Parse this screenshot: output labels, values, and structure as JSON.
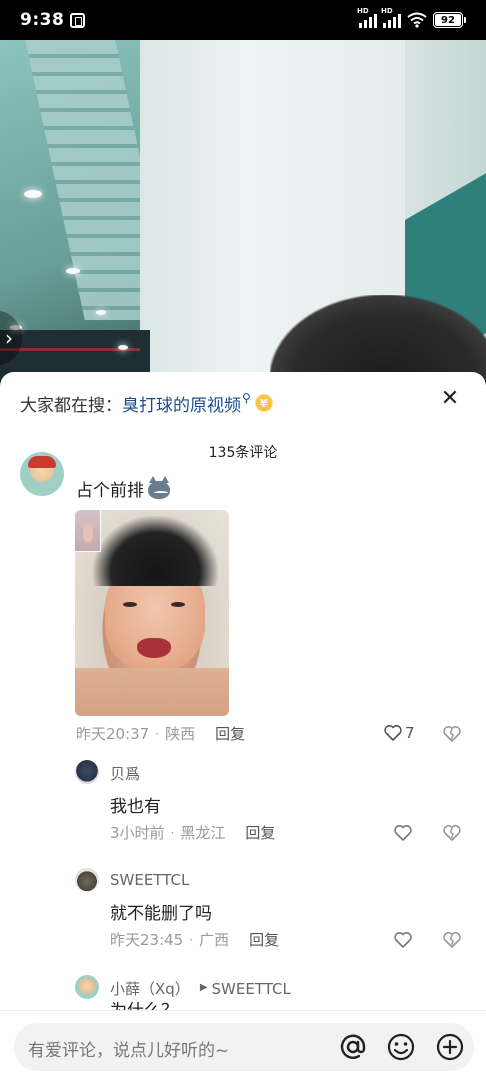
{
  "status_bar": {
    "time": "9:38",
    "signal_1_label": "HD",
    "signal_2_label": "HD",
    "battery_level": "92"
  },
  "video": {
    "side_arrow": "›"
  },
  "search": {
    "prefix": "大家都在搜：",
    "term": "臭打球的原视频",
    "magnifier": "⚲",
    "coin": "¥",
    "close": "✕"
  },
  "comments_header": "135条评论",
  "main_comment": {
    "text": "占个前排",
    "time": "昨天20:37",
    "location": "陕西",
    "reply_label": "回复",
    "likes": "7"
  },
  "replies": [
    {
      "name": "贝爲",
      "text": "我也有",
      "time": "3小时前",
      "location": "黑龙江",
      "reply_label": "回复"
    },
    {
      "name": "SWEETTCL",
      "text": "就不能删了吗",
      "time": "昨天23:45",
      "location": "广西",
      "reply_label": "回复"
    },
    {
      "name": "小薛（Xq）",
      "reply_to": "SWEETTCL",
      "text": "为什么？"
    }
  ],
  "input": {
    "placeholder": "有爱评论，说点儿好听的~"
  },
  "colors": {
    "search_term": "#1b4d8f",
    "meta_gray": "#9a9a9a",
    "coin": "#f5c542"
  },
  "icons": {
    "at": "at-icon",
    "emoji": "emoji-icon",
    "add": "add-icon",
    "heart": "heart-icon",
    "dislike": "broken-heart-icon"
  }
}
